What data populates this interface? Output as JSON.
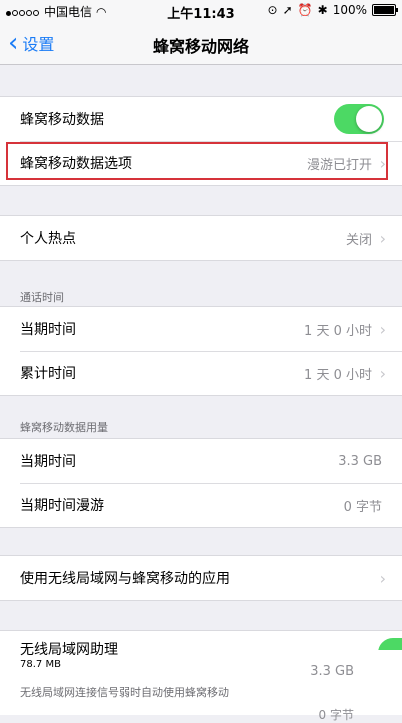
{
  "status": {
    "carrier": "中国电信",
    "time": "上午11:43",
    "battery": "100%"
  },
  "nav": {
    "back_label": "设置",
    "title": "蜂窝移动网络"
  },
  "cellular": {
    "data_label": "蜂窝移动数据",
    "data_on": true,
    "options_label": "蜂窝移动数据选项",
    "options_value": "漫游已打开"
  },
  "hotspot": {
    "label": "个人热点",
    "value": "关闭"
  },
  "call_time": {
    "header": "通话时间",
    "current_label": "当期时间",
    "current_value": "1 天 0 小时",
    "total_label": "累计时间",
    "total_value": "1 天 0 小时"
  },
  "usage": {
    "header": "蜂窝移动数据用量",
    "current_label": "当期时间",
    "current_value": "3.3 GB",
    "roaming_label": "当期时间漫游",
    "roaming_value": "0 字节"
  },
  "apps": {
    "label": "使用无线局域网与蜂窝移动的应用"
  },
  "wifi_assist": {
    "label": "无线局域网助理",
    "size": "78.7 MB",
    "value": "3.3 GB",
    "desc": "无线局域网连接信号弱时自动使用蜂窝移动",
    "value2": "0 字节"
  }
}
